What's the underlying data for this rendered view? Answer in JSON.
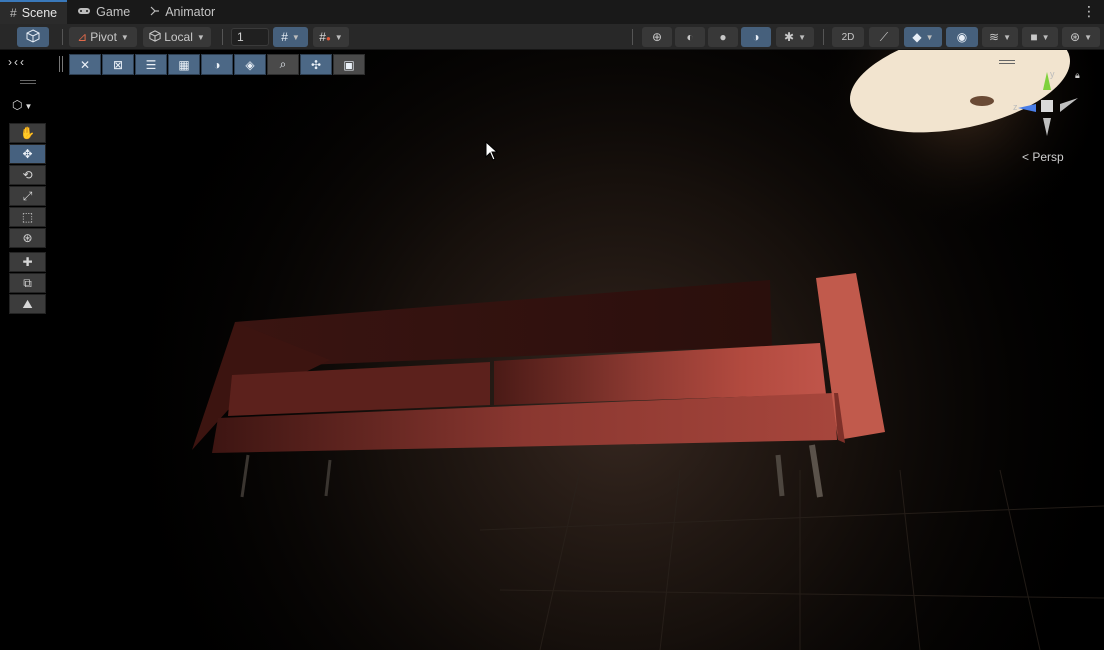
{
  "tabs": [
    {
      "label": "Scene",
      "icon": "grid-icon",
      "active": true
    },
    {
      "label": "Game",
      "icon": "gamepad-icon",
      "active": false
    },
    {
      "label": "Animator",
      "icon": "animator-icon",
      "active": false
    }
  ],
  "toolbar": {
    "pivot_label": "Pivot",
    "local_label": "Local",
    "grid_value": "1"
  },
  "viewport": {
    "persp_label": "Persp",
    "gizmo_axes": {
      "y": "y",
      "z": "z"
    }
  },
  "colors": {
    "accent": "#46607c",
    "sofa": "#b0473d",
    "background": "#000000"
  }
}
